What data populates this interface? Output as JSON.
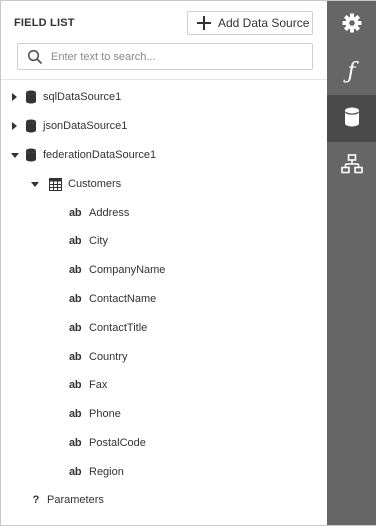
{
  "header": {
    "title": "FIELD LIST",
    "add_button_label": "Add Data Source"
  },
  "search": {
    "placeholder": "Enter text to search..."
  },
  "tree": {
    "sources": [
      {
        "label": "sqlDataSource1",
        "expanded": false
      },
      {
        "label": "jsonDataSource1",
        "expanded": false
      },
      {
        "label": "federationDataSource1",
        "expanded": true
      }
    ],
    "table": {
      "label": "Customers",
      "expanded": true
    },
    "fields": [
      "Address",
      "City",
      "CompanyName",
      "ContactName",
      "ContactTitle",
      "Country",
      "Fax",
      "Phone",
      "PostalCode",
      "Region"
    ],
    "field_type_glyph": "ab",
    "parameters": {
      "label": "Parameters",
      "glyph": "?"
    }
  },
  "sidebar": {
    "buttons": [
      {
        "icon": "gear-icon",
        "active": false
      },
      {
        "icon": "function-icon",
        "glyph": "ƒ",
        "active": false
      },
      {
        "icon": "database-icon",
        "active": true
      },
      {
        "icon": "hierarchy-icon",
        "active": false
      }
    ]
  },
  "colors": {
    "sidebar_bg": "#666666",
    "sidebar_active_bg": "#4a4a4a",
    "text": "#333333"
  }
}
